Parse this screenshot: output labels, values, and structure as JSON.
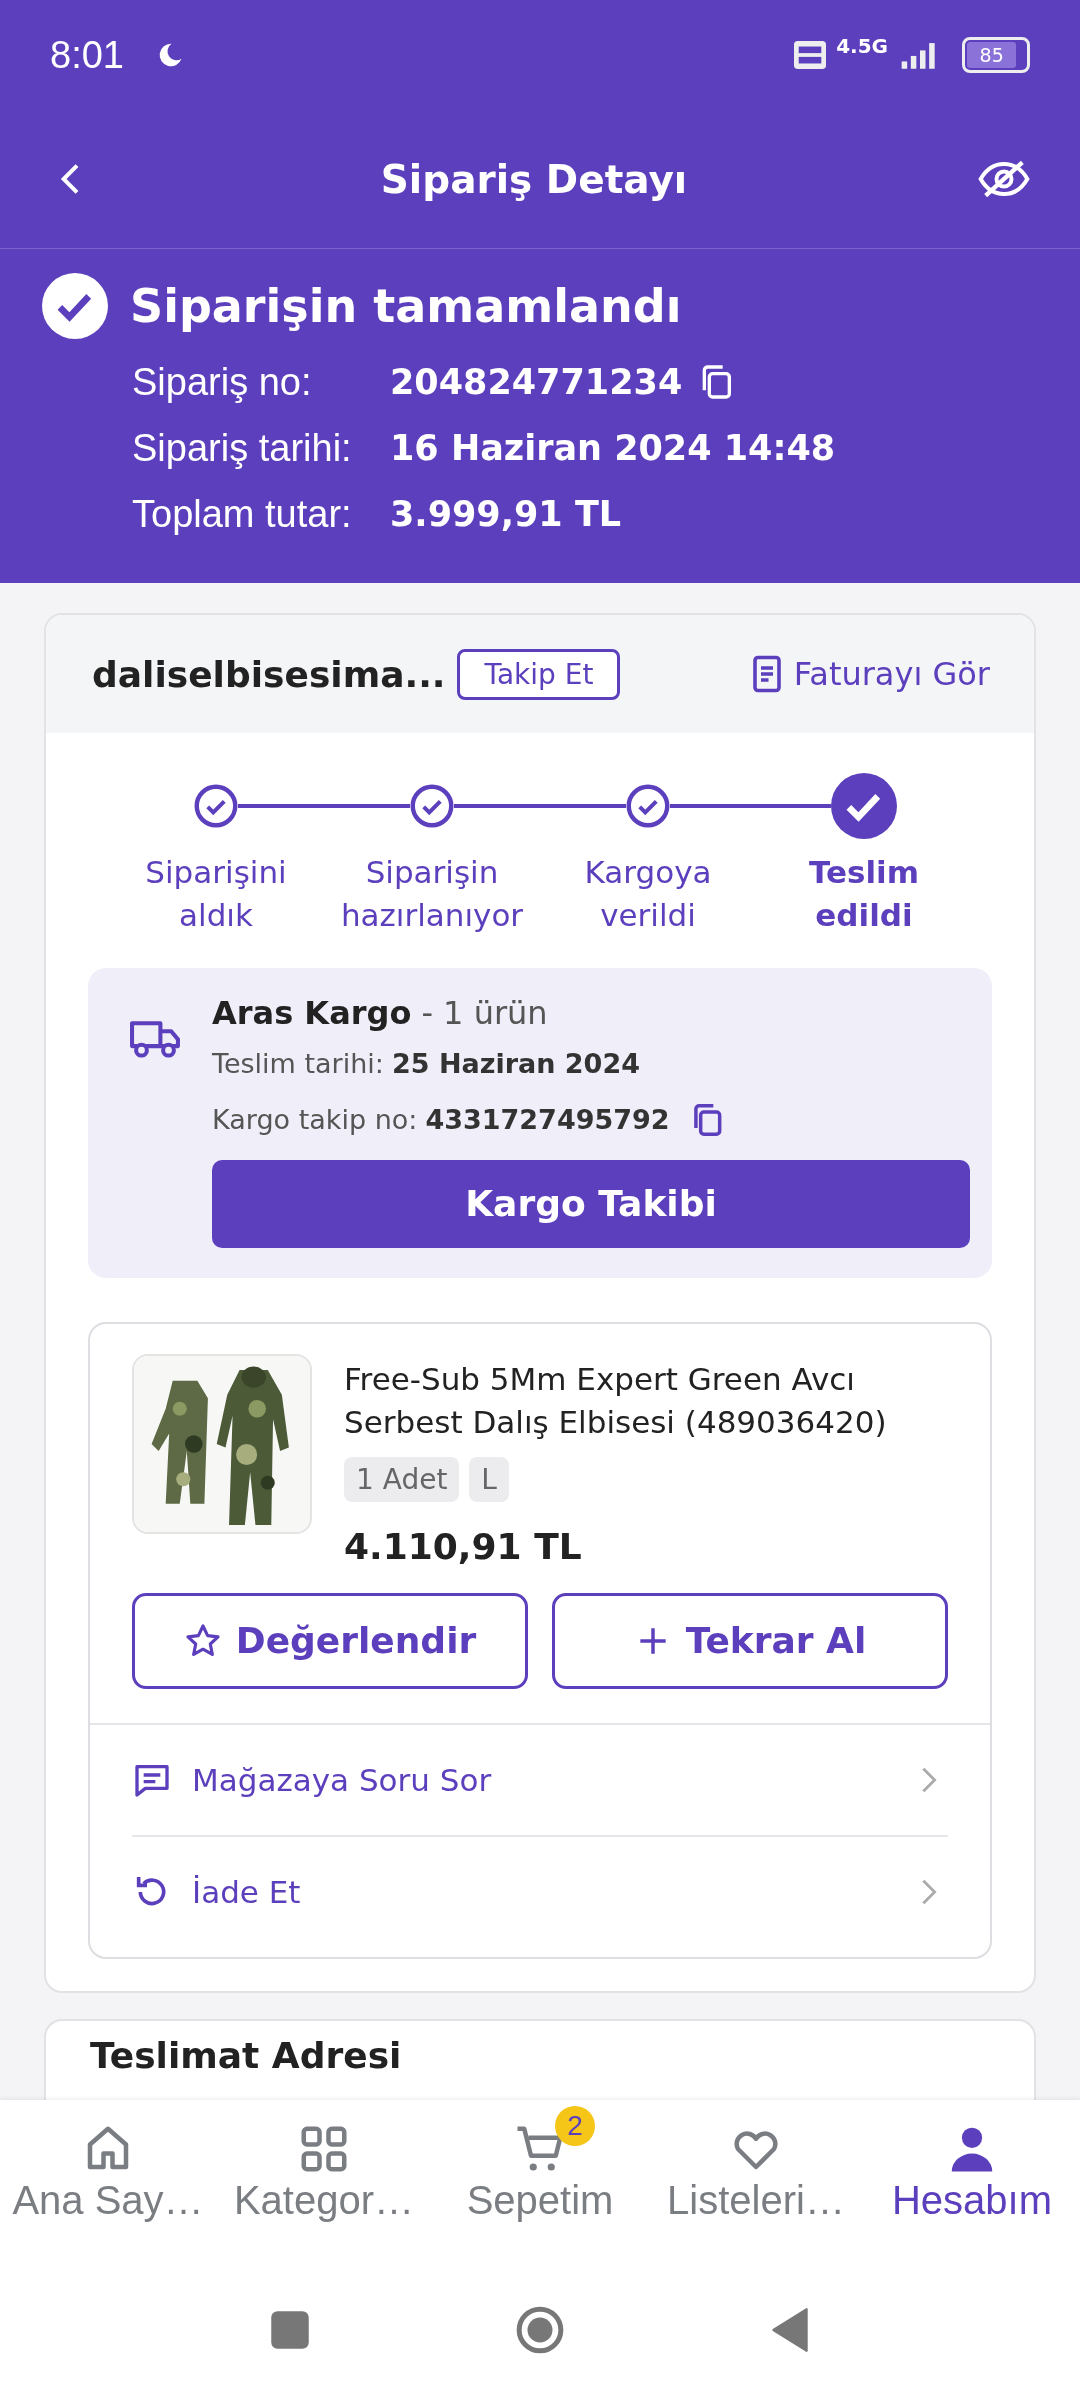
{
  "status_bar": {
    "time": "8:01",
    "network": "4.5G",
    "battery": "85"
  },
  "header": {
    "title": "Sipariş Detayı"
  },
  "summary": {
    "status": "Siparişin tamamlandı",
    "fields": [
      {
        "label": "Sipariş no:",
        "value": "204824771234",
        "copyable": true
      },
      {
        "label": "Sipariş tarihi:",
        "value": "16 Haziran 2024 14:48",
        "copyable": false
      },
      {
        "label": "Toplam tutar:",
        "value": "3.999,91 TL",
        "copyable": false
      }
    ]
  },
  "store": {
    "name": "daliselbisesima...",
    "follow": "Takip Et",
    "invoice": "Faturayı Gör"
  },
  "steps": [
    {
      "label": "Siparişini aldık",
      "current": false
    },
    {
      "label": "Siparişin hazırlanıyor",
      "current": false
    },
    {
      "label": "Kargoya verildi",
      "current": false
    },
    {
      "label": "Teslim edildi",
      "current": true
    }
  ],
  "shipment": {
    "carrier": "Aras Kargo",
    "count": "- 1 ürün",
    "date_label": "Teslim tarihi:",
    "date": "25 Haziran 2024",
    "tracking_label": "Kargo takip no:",
    "tracking": "4331727495792",
    "button": "Kargo Takibi"
  },
  "product": {
    "kind": "picture",
    "title": "Free-Sub 5Mm Expert Green Avcı Serbest Dalış Elbisesi (489036420)",
    "tags": [
      "1 Adet",
      "L"
    ],
    "price": "4.110,91 TL",
    "buttons": [
      "Değerlendir",
      "Tekrar Al"
    ],
    "links": [
      {
        "label": "Mağazaya Soru Sor",
        "kind": "question"
      },
      {
        "label": "İade Et",
        "kind": "return"
      }
    ]
  },
  "next_section": {
    "title": "Teslimat Adresi"
  },
  "bottom_nav": [
    {
      "label": "Ana Say…",
      "kind": "home",
      "selected": false
    },
    {
      "label": "Kategor…",
      "kind": "grid",
      "selected": false
    },
    {
      "label": "Sepetim",
      "kind": "cart",
      "selected": false,
      "badge": "2"
    },
    {
      "label": "Listeleri…",
      "kind": "heart",
      "selected": false
    },
    {
      "label": "Hesabım",
      "kind": "person",
      "selected": true
    }
  ]
}
